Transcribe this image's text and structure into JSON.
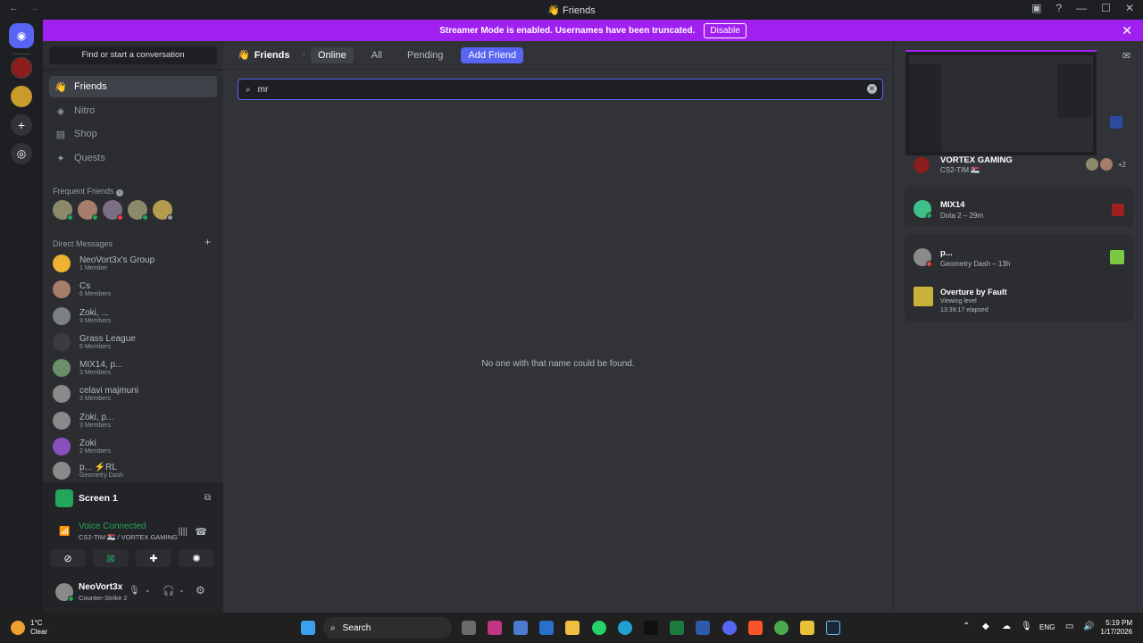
{
  "window": {
    "title": "Friends",
    "nav_back": "←",
    "nav_forward": "→"
  },
  "banner": {
    "text": "Streamer Mode is enabled. Usernames have been truncated.",
    "disable_label": "Disable",
    "close": "✕"
  },
  "sidebar": {
    "find_label": "Find or start a conversation",
    "nav": [
      {
        "label": "Friends",
        "icon": "friends-icon"
      },
      {
        "label": "Nitro",
        "icon": "nitro-icon"
      },
      {
        "label": "Shop",
        "icon": "shop-icon"
      },
      {
        "label": "Quests",
        "icon": "quests-icon"
      }
    ],
    "frequent_title": "Frequent Friends",
    "dm_title": "Direct Messages",
    "dm_add": "+",
    "dms": [
      {
        "name": "NeoVort3x's Group",
        "sub": "1 Member",
        "color": "#f0b232"
      },
      {
        "name": "Cs",
        "sub": "6 Members",
        "color": "#a67c6b"
      },
      {
        "name": "Zoki, ...",
        "sub": "3 Members",
        "color": "#7b7f86"
      },
      {
        "name": "Grass League",
        "sub": "6 Members",
        "color": "#3a3c41"
      },
      {
        "name": "MIX14, p...",
        "sub": "3 Members",
        "color": "#6b8e6b"
      },
      {
        "name": "celavi majmuni",
        "sub": "3 Members",
        "color": "#8a8a8a"
      },
      {
        "name": "Zoki, p...",
        "sub": "3 Members",
        "color": "#8a8a8a"
      },
      {
        "name": "Zoki",
        "sub": "2 Members",
        "color": "#8a4fbf"
      },
      {
        "name": "p... ⚡RL",
        "sub": "Geometry Dash",
        "color": "#8a8a8a"
      }
    ]
  },
  "panel": {
    "screen_label": "Screen 1",
    "voice_status": "Voice Connected",
    "voice_channel": "CS2-TIM 🇷🇸 / VORTEX GAMING",
    "user_name": "NeoVort3x",
    "user_activity": "Counter-Strike 2"
  },
  "header": {
    "title": "Friends",
    "tabs": [
      "Online",
      "All",
      "Pending"
    ],
    "add_friend": "Add Friend"
  },
  "search": {
    "value": "mr",
    "clear": "✕"
  },
  "empty_message": "No one with that name could be found.",
  "activity": [
    {
      "name": "VORTEX GAMING",
      "sub": "CS2-TIM 🇷🇸",
      "extra": "+2"
    },
    {
      "name": "MIX14",
      "sub": "Dota 2 – 29m"
    },
    {
      "name": "p...",
      "sub": "Geometry Dash – 13h"
    },
    {
      "name": "Overture by Fault",
      "sub": "Viewing level",
      "sub2": "13:39:17 elapsed"
    }
  ],
  "taskbar": {
    "weather_temp": "1°C",
    "weather_text": "Clear",
    "search_label": "Search",
    "lang": "ENG",
    "time": "5:19 PM",
    "date": "1/17/2026"
  },
  "colors": {
    "accent": "#5865f2",
    "banner": "#a020f0",
    "online": "#23a55a",
    "dnd": "#f23f43"
  }
}
